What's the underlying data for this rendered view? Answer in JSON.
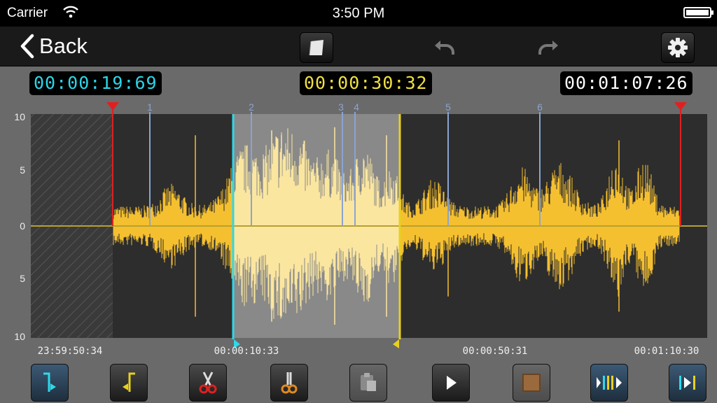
{
  "status_bar": {
    "carrier": "Carrier",
    "time": "3:50 PM"
  },
  "nav": {
    "back_label": "Back"
  },
  "timecodes": {
    "left": {
      "value": "00:00:19:69",
      "color": "#2ad6e8"
    },
    "center": {
      "value": "00:00:30:32",
      "color": "#f0e040"
    },
    "right": {
      "value": "00:01:07:26",
      "color": "#ffffff"
    }
  },
  "waveform": {
    "y_ticks": [
      "10",
      "5",
      "0",
      "5",
      "10"
    ],
    "time_labels": [
      "23:59:50:34",
      "00:00:10:33",
      "00:00:50:31",
      "00:01:10:30"
    ],
    "markers": [
      "1",
      "2",
      "3",
      "4",
      "5",
      "6"
    ],
    "colors": {
      "wave": "#f5c030",
      "selection_wave": "#fbe6a0",
      "trim": "#e02020",
      "start": "#30d8e8",
      "end": "#e8d020",
      "marker": "#8aa4d0"
    }
  },
  "toolbar": {
    "buttons": [
      {
        "name": "set-start-button",
        "icon": "bracket-start-icon"
      },
      {
        "name": "set-end-button",
        "icon": "bracket-end-icon"
      },
      {
        "name": "cut-button",
        "icon": "scissors-red-icon"
      },
      {
        "name": "trim-button",
        "icon": "scissors-orange-icon"
      },
      {
        "name": "paste-button",
        "icon": "clipboard-icon"
      },
      {
        "name": "play-button",
        "icon": "play-icon"
      },
      {
        "name": "stop-button",
        "icon": "stop-icon"
      },
      {
        "name": "play-selection-button",
        "icon": "play-selection-icon"
      },
      {
        "name": "play-to-end-button",
        "icon": "play-to-end-icon"
      }
    ]
  }
}
